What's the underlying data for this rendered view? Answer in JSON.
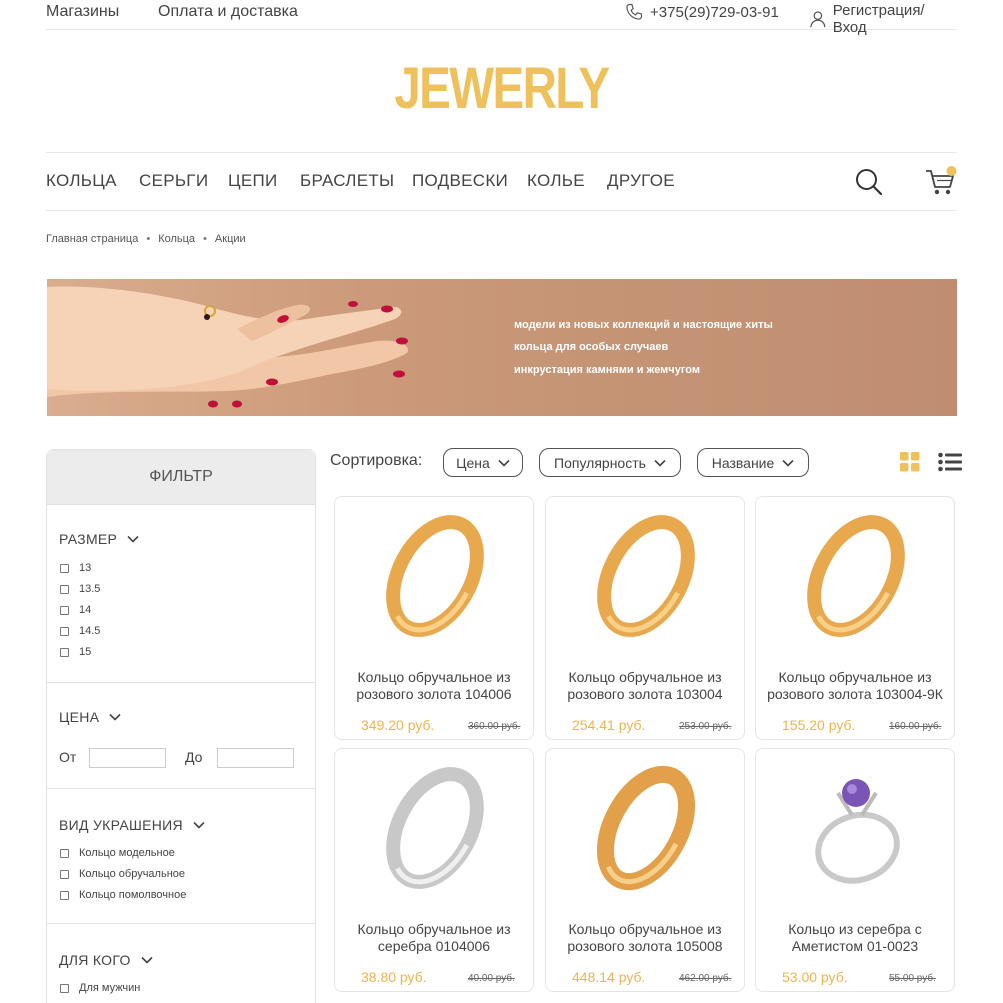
{
  "topbar": {
    "stores": "Магазины",
    "delivery": "Оплата и доставка",
    "phone": "+375(29)729-03-91",
    "login": "Регистрация/Вход"
  },
  "logo": "JEWERLY",
  "nav": [
    "КОЛЬЦА",
    "СЕРЬГИ",
    "ЦЕПИ",
    "БРАСЛЕТЫ",
    "ПОДВЕСКИ",
    "КОЛЬЕ",
    "ДРУГОЕ"
  ],
  "breadcrumbs": [
    "Главная страница",
    "Кольца",
    "Акции"
  ],
  "banner": [
    "модели из новых коллекций и настоящие хиты",
    "кольца для особых случаев",
    "инкрустация камнями и жемчугом"
  ],
  "filter": {
    "title": "ФИЛЬТР",
    "size": {
      "title": "РАЗМЕР",
      "options": [
        "13",
        "13.5",
        "14",
        "14.5",
        "15"
      ]
    },
    "price": {
      "title": "ЦЕНА",
      "from": "От",
      "to": "До"
    },
    "kind": {
      "title": "ВИД УКРАШЕНИЯ",
      "options": [
        "Кольцо модельное",
        "Кольцо обручальное",
        "Кольцо помолвочное"
      ]
    },
    "who": {
      "title": "ДЛЯ КОГО",
      "options": [
        "Для мужчин"
      ]
    }
  },
  "sort": {
    "label": "Сортировка:",
    "options": [
      "Цена",
      "Популярность",
      "Название"
    ]
  },
  "colors": {
    "accent": "#efc15c",
    "price": "#efb44f"
  },
  "products": [
    {
      "name": "Кольцо обручальное из розового золота 104006",
      "price": "349.20 руб.",
      "old": "360.00 руб.",
      "image": "gold-ring"
    },
    {
      "name": "Кольцо обручальное из розового золота 103004",
      "price": "254.41 руб.",
      "old": "253.00 руб.",
      "image": "gold-ring"
    },
    {
      "name": "Кольцо обручальное из розового золота 103004-9К",
      "price": "155.20 руб.",
      "old": "160.00 руб.",
      "image": "gold-ring"
    },
    {
      "name": "Кольцо обручальное из серебра 0104006",
      "price": "38.80 руб.",
      "old": "40.00 руб.",
      "image": "silver-ring"
    },
    {
      "name": "Кольцо обручальное из розового золота 105008",
      "price": "448.14 руб.",
      "old": "462.00 руб.",
      "image": "gold-ring"
    },
    {
      "name": "Кольцо из серебра с Аметистом 01-0023",
      "price": "53.00 руб.",
      "old": "55.00 руб.",
      "image": "amethyst-ring"
    }
  ]
}
